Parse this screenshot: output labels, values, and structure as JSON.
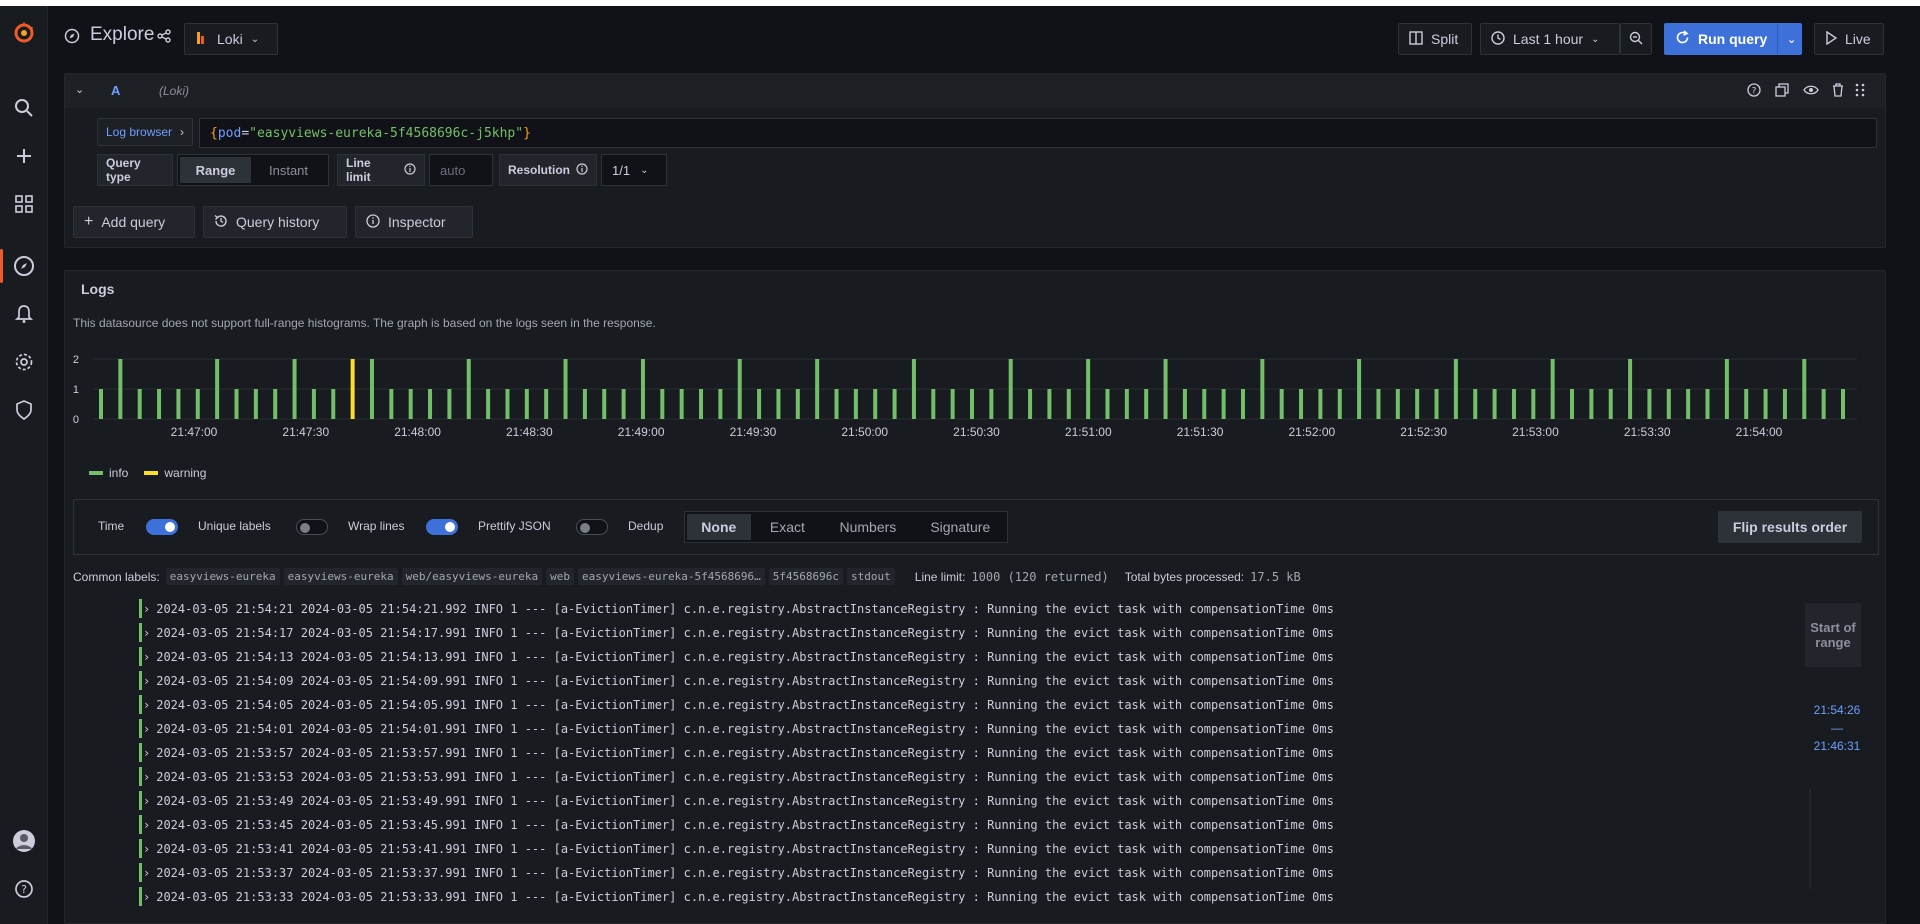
{
  "topbar": {
    "title": "Explore",
    "datasource": "Loki",
    "split_label": "Split",
    "time_range": "Last 1 hour",
    "run_query_label": "Run query",
    "live_label": "Live"
  },
  "query": {
    "ref_id": "A",
    "ds_name": "(Loki)",
    "log_browser_label": "Log browser",
    "expression_open": "{",
    "expression_key": "pod",
    "expression_eq": "=",
    "expression_value": "\"easyviews-eureka-5f4568696c-j5khp\"",
    "expression_close": "}",
    "query_type_label": "Query type",
    "query_type_options": [
      "Range",
      "Instant"
    ],
    "line_limit_label": "Line limit",
    "line_limit_placeholder": "auto",
    "resolution_label": "Resolution",
    "resolution_value": "1/1"
  },
  "actions": {
    "add_query": "Add query",
    "query_history": "Query history",
    "inspector": "Inspector"
  },
  "logs": {
    "title": "Logs",
    "notice": "This datasource does not support full-range histograms. The graph is based on the logs seen in the response.",
    "legend": [
      {
        "label": "info",
        "color": "#73bf69"
      },
      {
        "label": "warning",
        "color": "#fade2a"
      }
    ],
    "options": {
      "time": "Time",
      "unique_labels": "Unique labels",
      "wrap_lines": "Wrap lines",
      "prettify_json": "Prettify JSON",
      "dedup": "Dedup",
      "dedup_options": [
        "None",
        "Exact",
        "Numbers",
        "Signature"
      ],
      "flip": "Flip results order"
    },
    "common_labels_title": "Common labels:",
    "common_labels": [
      "easyviews-eureka",
      "easyviews-eureka",
      "web/easyviews-eureka",
      "web",
      "easyviews-eureka-5f4568696…",
      "5f4568696c",
      "stdout"
    ],
    "line_limit_title": "Line limit:",
    "line_limit_value": "1000 (120 returned)",
    "bytes_title": "Total bytes processed:",
    "bytes_value": "17.5 kB",
    "range_label": "Start of range",
    "range_start": "21:54:26",
    "range_dash": "—",
    "range_end": "21:46:31",
    "rows": [
      "2024-03-05 21:54:21 2024-03-05 21:54:21.992  INFO 1 --- [a-EvictionTimer] c.n.e.registry.AbstractInstanceRegistry  : Running the evict task with compensationTime 0ms",
      "2024-03-05 21:54:17 2024-03-05 21:54:17.991  INFO 1 --- [a-EvictionTimer] c.n.e.registry.AbstractInstanceRegistry  : Running the evict task with compensationTime 0ms",
      "2024-03-05 21:54:13 2024-03-05 21:54:13.991  INFO 1 --- [a-EvictionTimer] c.n.e.registry.AbstractInstanceRegistry  : Running the evict task with compensationTime 0ms",
      "2024-03-05 21:54:09 2024-03-05 21:54:09.991  INFO 1 --- [a-EvictionTimer] c.n.e.registry.AbstractInstanceRegistry  : Running the evict task with compensationTime 0ms",
      "2024-03-05 21:54:05 2024-03-05 21:54:05.991  INFO 1 --- [a-EvictionTimer] c.n.e.registry.AbstractInstanceRegistry  : Running the evict task with compensationTime 0ms",
      "2024-03-05 21:54:01 2024-03-05 21:54:01.991  INFO 1 --- [a-EvictionTimer] c.n.e.registry.AbstractInstanceRegistry  : Running the evict task with compensationTime 0ms",
      "2024-03-05 21:53:57 2024-03-05 21:53:57.991  INFO 1 --- [a-EvictionTimer] c.n.e.registry.AbstractInstanceRegistry  : Running the evict task with compensationTime 0ms",
      "2024-03-05 21:53:53 2024-03-05 21:53:53.991  INFO 1 --- [a-EvictionTimer] c.n.e.registry.AbstractInstanceRegistry  : Running the evict task with compensationTime 0ms",
      "2024-03-05 21:53:49 2024-03-05 21:53:49.991  INFO 1 --- [a-EvictionTimer] c.n.e.registry.AbstractInstanceRegistry  : Running the evict task with compensationTime 0ms",
      "2024-03-05 21:53:45 2024-03-05 21:53:45.991  INFO 1 --- [a-EvictionTimer] c.n.e.registry.AbstractInstanceRegistry  : Running the evict task with compensationTime 0ms",
      "2024-03-05 21:53:41 2024-03-05 21:53:41.991  INFO 1 --- [a-EvictionTimer] c.n.e.registry.AbstractInstanceRegistry  : Running the evict task with compensationTime 0ms",
      "2024-03-05 21:53:37 2024-03-05 21:53:37.991  INFO 1 --- [a-EvictionTimer] c.n.e.registry.AbstractInstanceRegistry  : Running the evict task with compensationTime 0ms",
      "2024-03-05 21:53:33 2024-03-05 21:53:33.991  INFO 1 --- [a-EvictionTimer] c.n.e.registry.AbstractInstanceRegistry  : Running the evict task with compensationTime 0ms"
    ]
  },
  "chart_data": {
    "type": "bar",
    "ylim": [
      0,
      2
    ],
    "yticks": [
      0,
      1,
      2
    ],
    "xticks": [
      "21:47:00",
      "21:47:30",
      "21:48:00",
      "21:48:30",
      "21:49:00",
      "21:49:30",
      "21:50:00",
      "21:50:30",
      "21:51:00",
      "21:51:30",
      "21:52:00",
      "21:52:30",
      "21:53:00",
      "21:53:30",
      "21:54:00"
    ],
    "series": [
      {
        "name": "info",
        "values": [
          1,
          2,
          1,
          1,
          1,
          1,
          2,
          1,
          1,
          1,
          2,
          1,
          1,
          0,
          2,
          1,
          1,
          1,
          1,
          2,
          1,
          1,
          1,
          1,
          2,
          1,
          1,
          1,
          2,
          1,
          1,
          1,
          1,
          2,
          1,
          1,
          1,
          2,
          1,
          1,
          1,
          1,
          2,
          1,
          1,
          1,
          1,
          2,
          1,
          1,
          1,
          2,
          1,
          1,
          1,
          2,
          1,
          1,
          1,
          1,
          2,
          1,
          1,
          1,
          1,
          2,
          1,
          1,
          1,
          1,
          2,
          1,
          1,
          1,
          1,
          2,
          1,
          1,
          1,
          2,
          1,
          1,
          1,
          1,
          2,
          1,
          1,
          1,
          2,
          1,
          1
        ]
      },
      {
        "name": "warning",
        "values": [
          0,
          0,
          0,
          0,
          0,
          0,
          0,
          0,
          0,
          0,
          0,
          0,
          0,
          2,
          0,
          0,
          0,
          0,
          0,
          0,
          0,
          0,
          0,
          0,
          0,
          0,
          0,
          0,
          0,
          0,
          0,
          0,
          0,
          0,
          0,
          0,
          0,
          0,
          0,
          0,
          0,
          0,
          0,
          0,
          0,
          0,
          0,
          0,
          0,
          0,
          0,
          0,
          0,
          0,
          0,
          0,
          0,
          0,
          0,
          0,
          0,
          0,
          0,
          0,
          0,
          0,
          0,
          0,
          0,
          0,
          0,
          0,
          0,
          0,
          0,
          0,
          0,
          0,
          0,
          0,
          0,
          0,
          0,
          0,
          0,
          0,
          0,
          0,
          0,
          0,
          0
        ]
      }
    ]
  }
}
